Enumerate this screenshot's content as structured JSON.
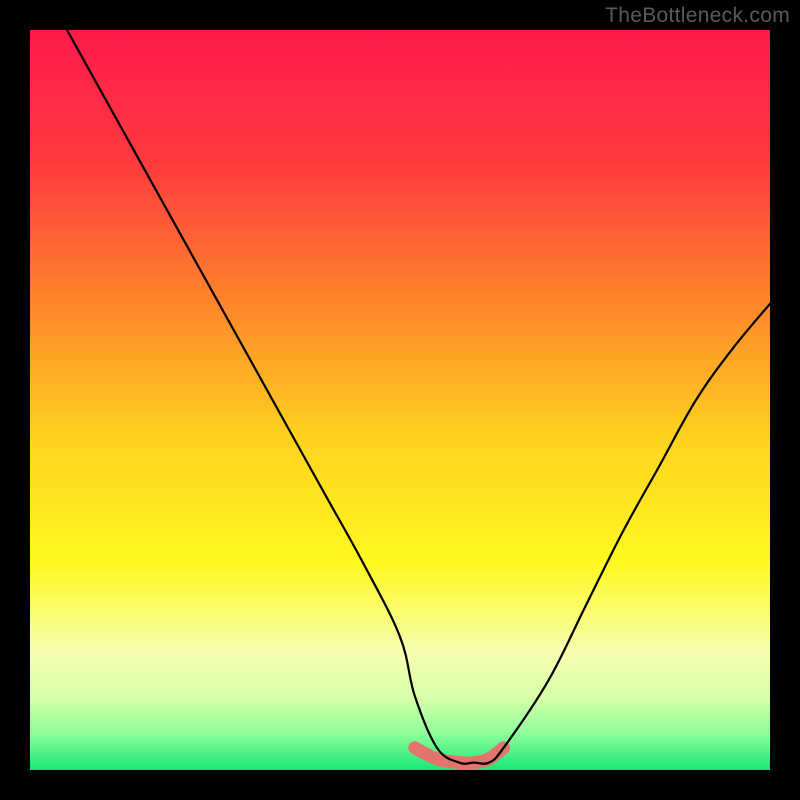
{
  "watermark": "TheBottleneck.com",
  "chart_data": {
    "type": "line",
    "title": "",
    "xlabel": "",
    "ylabel": "",
    "xlim": [
      0,
      100
    ],
    "ylim": [
      0,
      100
    ],
    "series": [
      {
        "name": "bottleneck-curve",
        "x": [
          5,
          10,
          15,
          20,
          25,
          30,
          35,
          40,
          45,
          50,
          52,
          55,
          58,
          60,
          62,
          64,
          70,
          75,
          80,
          85,
          90,
          95,
          100
        ],
        "values": [
          100,
          91,
          82,
          73,
          64,
          55,
          46,
          37,
          28,
          18,
          10,
          3,
          1,
          1,
          1,
          3,
          12,
          22,
          32,
          41,
          50,
          57,
          63
        ]
      },
      {
        "name": "highlight-band",
        "x": [
          52,
          55,
          58,
          60,
          62,
          64
        ],
        "values": [
          3,
          1.5,
          1,
          1,
          1.5,
          3
        ]
      }
    ],
    "gradient_stops": [
      {
        "pos": 0.0,
        "color": "#ff1a4b"
      },
      {
        "pos": 0.18,
        "color": "#ff3a3f"
      },
      {
        "pos": 0.38,
        "color": "#ff8a2a"
      },
      {
        "pos": 0.55,
        "color": "#ffd21f"
      },
      {
        "pos": 0.72,
        "color": "#fff820"
      },
      {
        "pos": 0.84,
        "color": "#f6ffb0"
      },
      {
        "pos": 0.9,
        "color": "#d9ffa8"
      },
      {
        "pos": 0.95,
        "color": "#8fff9a"
      },
      {
        "pos": 1.0,
        "color": "#17e876"
      }
    ]
  }
}
